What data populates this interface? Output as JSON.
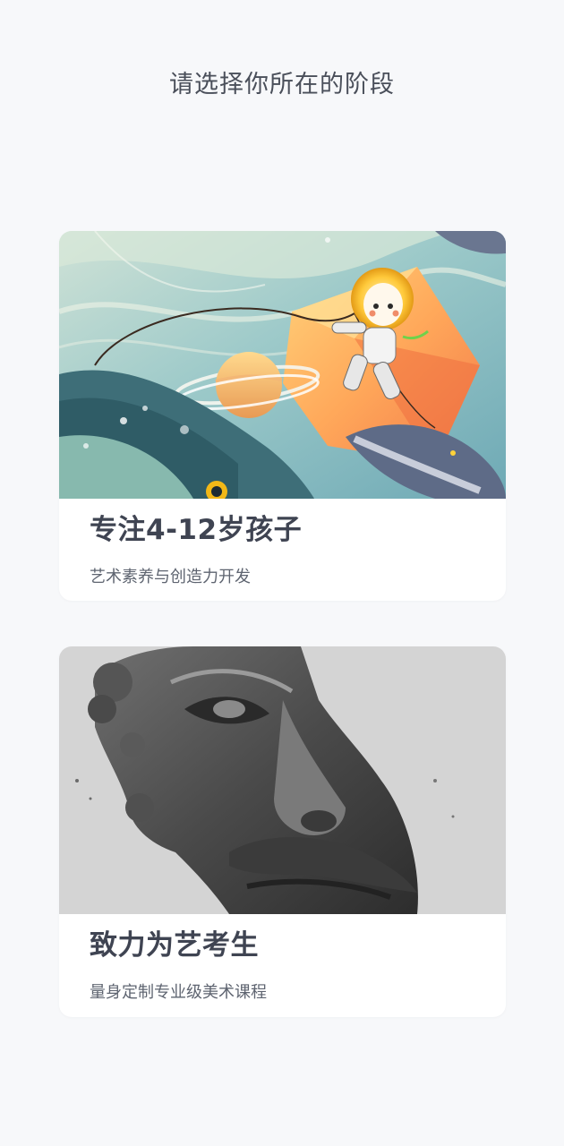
{
  "header": {
    "title": "请选择你所在的阶段"
  },
  "stages": [
    {
      "title": "专注4-12岁孩子",
      "subtitle": "艺术素养与创造力开发",
      "image": "space-astronaut-illustration"
    },
    {
      "title": "致力为艺考生",
      "subtitle": "量身定制专业级美术课程",
      "image": "marble-statue-face"
    }
  ]
}
